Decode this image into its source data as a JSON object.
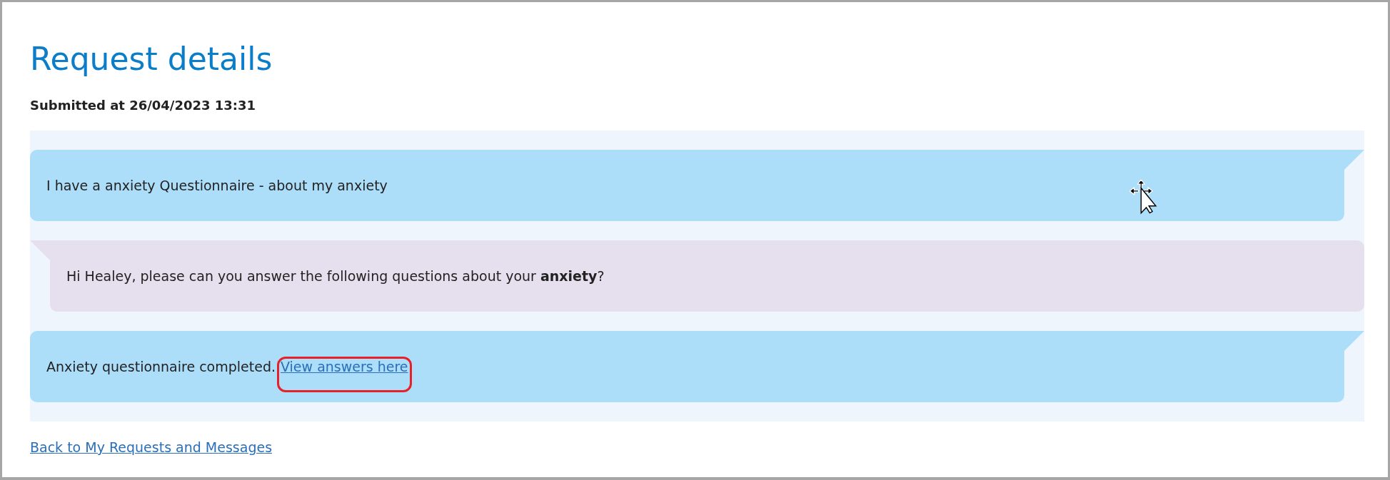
{
  "page": {
    "title": "Request details",
    "submitted": "Submitted at 26/04/2023 13:31"
  },
  "messages": [
    {
      "kind": "sent",
      "text": "I have a anxiety Questionnaire - about my anxiety"
    },
    {
      "kind": "received",
      "text": "Hi Healey, please can you answer the following questions about your **anxiety**?"
    },
    {
      "kind": "sent",
      "text": "Anxiety questionnaire completed.",
      "link": {
        "label": "View answers here",
        "highlighted": true
      }
    }
  ],
  "back_link": "Back to My Requests and Messages"
}
